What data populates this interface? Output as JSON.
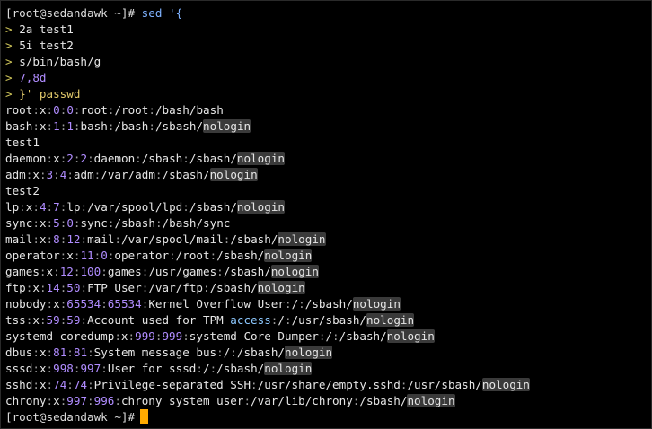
{
  "prompt": "[root@sedandawk ~]#",
  "command": {
    "first_line": "sed '{",
    "continuation_marker": ">",
    "lines": [
      "2a test1",
      "5i test2",
      "s/bin/bash/g",
      "7,8d",
      "}' passwd"
    ]
  },
  "output": [
    {
      "text": "root:x:0:0:root:/root:/bash/bash"
    },
    {
      "text": "bash:x:1:1:bash:/bash:/sbash/nologin"
    },
    {
      "text": "test1"
    },
    {
      "text": "daemon:x:2:2:daemon:/sbash:/sbash/nologin"
    },
    {
      "text": "adm:x:3:4:adm:/var/adm:/sbash/nologin"
    },
    {
      "text": "test2"
    },
    {
      "text": "lp:x:4:7:lp:/var/spool/lpd:/sbash/nologin"
    },
    {
      "text": "sync:x:5:0:sync:/sbash:/bash/sync"
    },
    {
      "text": "mail:x:8:12:mail:/var/spool/mail:/sbash/nologin"
    },
    {
      "text": "operator:x:11:0:operator:/root:/sbash/nologin"
    },
    {
      "text": "games:x:12:100:games:/usr/games:/sbash/nologin"
    },
    {
      "text": "ftp:x:14:50:FTP User:/var/ftp:/sbash/nologin"
    },
    {
      "text": "nobody:x:65534:65534:Kernel Overflow User:/:/sbash/nologin"
    },
    {
      "text": "tss:x:59:59:Account used for TPM access:/:/usr/sbash/nologin"
    },
    {
      "text": "systemd-coredump:x:999:999:systemd Core Dumper:/:/sbash/nologin"
    },
    {
      "text": "dbus:x:81:81:System message bus:/:/sbash/nologin"
    },
    {
      "text": "sssd:x:998:997:User for sssd:/:/sbash/nologin"
    },
    {
      "text": "sshd:x:74:74:Privilege-separated SSH:/usr/share/empty.sshd:/usr/sbash/nologin"
    },
    {
      "text": "chrony:x:997:996:chrony system user:/var/lib/chrony:/sbash/nologin"
    }
  ],
  "colors": {
    "background": "#000000",
    "prompt": "#dcdcdc",
    "command": "#7fb2ff",
    "continuation": "#d0c65a",
    "number": "#b08cff",
    "highlight_bg": "#3a3a3a",
    "cursor": "#ffaa00"
  }
}
